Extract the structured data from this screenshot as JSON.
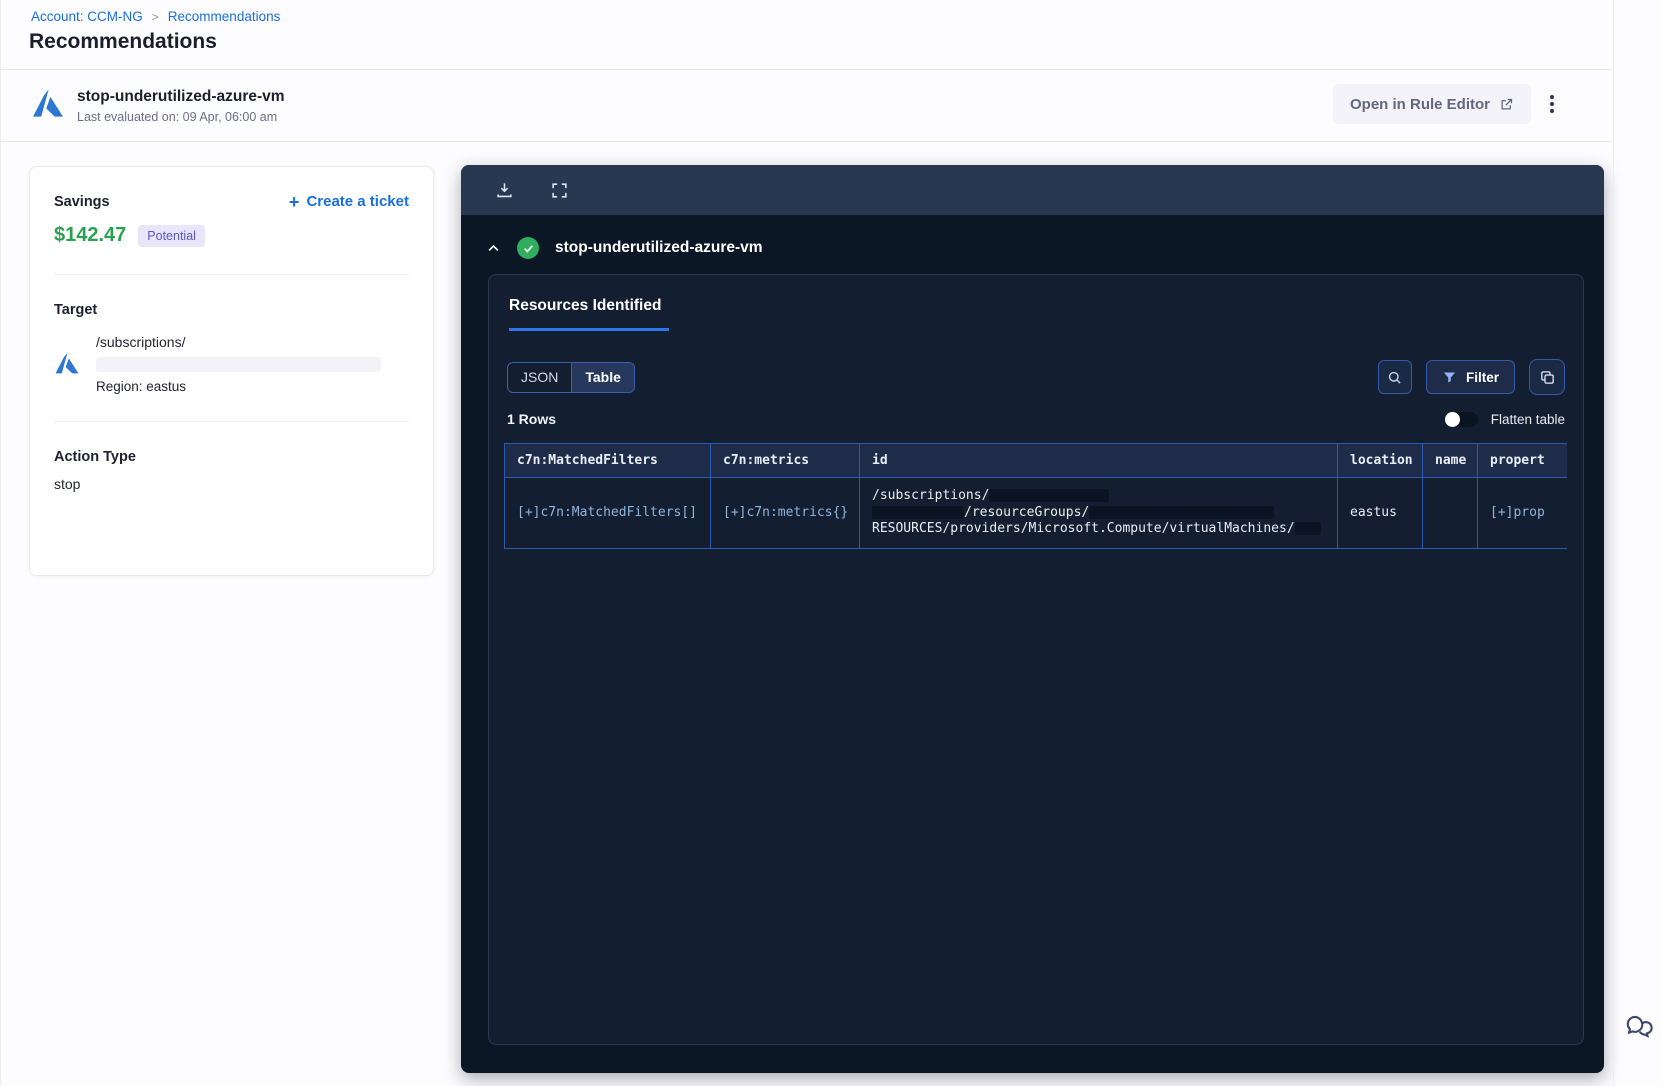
{
  "breadcrumb": {
    "account": "Account: CCM-NG",
    "separator": ">",
    "current": "Recommendations"
  },
  "page_title": "Recommendations",
  "header": {
    "rule_name": "stop-underutilized-azure-vm",
    "last_evaluated": "Last evaluated on: 09 Apr, 06:00 am",
    "open_rule_editor": "Open in Rule Editor"
  },
  "savings": {
    "label": "Savings",
    "amount": "$142.47",
    "badge": "Potential",
    "plus": "+",
    "create_ticket": "Create a ticket"
  },
  "target": {
    "label": "Target",
    "path": "/subscriptions/",
    "region": "Region: eastus"
  },
  "action": {
    "label": "Action Type",
    "value": "stop"
  },
  "viewer": {
    "title": "stop-underutilized-azure-vm",
    "tab": "Resources Identified",
    "seg_json": "JSON",
    "seg_table": "Table",
    "filter_label": "Filter",
    "rows_count": "1 Rows",
    "flatten_label": "Flatten table"
  },
  "table": {
    "headers": [
      "c7n:MatchedFilters",
      "c7n:metrics",
      "id",
      "location",
      "name",
      "propert"
    ],
    "row": {
      "matched_filters": "[+]c7n:MatchedFilters[]",
      "metrics": "[+]c7n:metrics{}",
      "id_line1": "/subscriptions/",
      "id_line2": "/resourceGroups/",
      "id_line3": "RESOURCES/providers/Microsoft.Compute/virtualMachines/",
      "location": "eastus",
      "name": "",
      "properties": "[+]prop"
    }
  },
  "colors": {
    "accent_blue": "#1a6fe0",
    "savings_green": "#2aa150",
    "badge_purple": "#5f53cc",
    "panel_bg": "#0c1726",
    "toolbar_bg": "#283850",
    "table_border": "#2b5ab0",
    "success_green": "#2fae5e"
  }
}
